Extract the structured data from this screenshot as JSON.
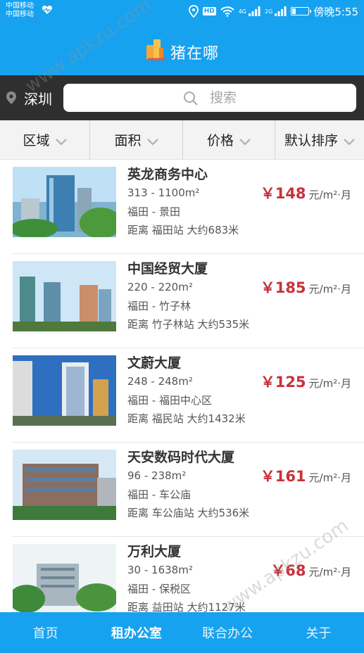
{
  "status_bar": {
    "carrier_1": "中国移动",
    "carrier_2": "中国移动",
    "hd": "HD",
    "net_1": "4G",
    "net_2": "2G",
    "time": "傍晚5:55",
    "battery_level": 0.25
  },
  "header": {
    "title": "猪在哪"
  },
  "search": {
    "city": "深圳",
    "placeholder": "搜索"
  },
  "filters": [
    "区域",
    "面积",
    "价格",
    "默认排序"
  ],
  "listings": [
    {
      "name": "英龙商务中心",
      "area": "313 - 1100m²",
      "district": "福田 - 景田",
      "distance": "距离 福田站 大约683米",
      "price": "￥148",
      "unit": "元/m²·月"
    },
    {
      "name": "中国经贸大厦",
      "area": "220 - 220m²",
      "district": "福田 - 竹子林",
      "distance": "距离 竹子林站 大约535米",
      "price": "￥185",
      "unit": "元/m²·月"
    },
    {
      "name": "文蔚大厦",
      "area": "248 - 248m²",
      "district": "福田 - 福田中心区",
      "distance": "距离 福民站 大约1432米",
      "price": "￥125",
      "unit": "元/m²·月"
    },
    {
      "name": "天安数码时代大厦",
      "area": "96 - 238m²",
      "district": "福田 - 车公庙",
      "distance": "距离 车公庙站 大约536米",
      "price": "￥161",
      "unit": "元/m²·月"
    },
    {
      "name": "万利大厦",
      "area": "30 - 1638m²",
      "district": "福田 - 保税区",
      "distance": "距离 益田站 大约1127米",
      "price": "￥68",
      "unit": "元/m²·月"
    }
  ],
  "bottom_nav": [
    {
      "label": "首页",
      "active": false
    },
    {
      "label": "租办公室",
      "active": true
    },
    {
      "label": "联合办公",
      "active": false
    },
    {
      "label": "关于",
      "active": false
    }
  ],
  "watermark": "www.apkzu.com",
  "colors": {
    "primary": "#17a2ef",
    "price": "#c8323a",
    "search_bg": "#2f2f2f"
  }
}
